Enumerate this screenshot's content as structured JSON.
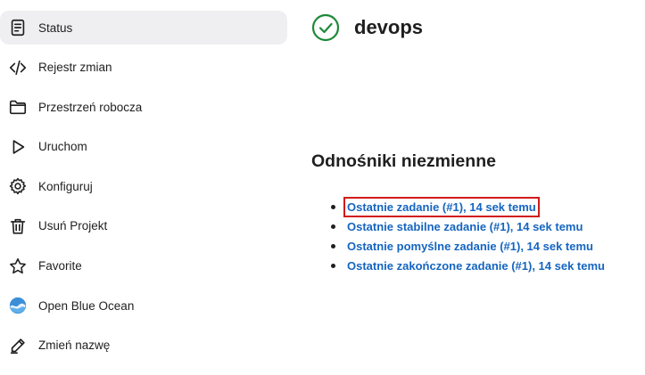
{
  "sidebar": {
    "items": [
      {
        "label": "Status",
        "icon": "status-document-icon",
        "active": true
      },
      {
        "label": "Rejestr zmian",
        "icon": "code-icon"
      },
      {
        "label": "Przestrzeń robocza",
        "icon": "folder-icon"
      },
      {
        "label": "Uruchom",
        "icon": "play-icon"
      },
      {
        "label": "Konfiguruj",
        "icon": "gear-icon"
      },
      {
        "label": "Usuń Projekt",
        "icon": "trash-icon"
      },
      {
        "label": "Favorite",
        "icon": "star-icon"
      },
      {
        "label": "Open Blue Ocean",
        "icon": "blue-ocean-icon"
      },
      {
        "label": "Zmień nazwę",
        "icon": "pencil-icon"
      }
    ]
  },
  "job": {
    "name": "devops",
    "status_icon": "success-check-icon",
    "status_color": "#1e8a3a"
  },
  "permalinks": {
    "title": "Odnośniki niezmienne",
    "links": [
      {
        "label": "Ostatnie zadanie (#1), 14 sek temu",
        "highlighted": true
      },
      {
        "label": "Ostatnie stabilne zadanie (#1), 14 sek temu"
      },
      {
        "label": "Ostatnie pomyślne zadanie (#1), 14 sek temu"
      },
      {
        "label": "Ostatnie zakończone zadanie (#1), 14 sek temu"
      }
    ]
  },
  "colors": {
    "link": "#1565c0",
    "highlight_border": "#d11a1a",
    "active_bg": "#efeff2"
  }
}
